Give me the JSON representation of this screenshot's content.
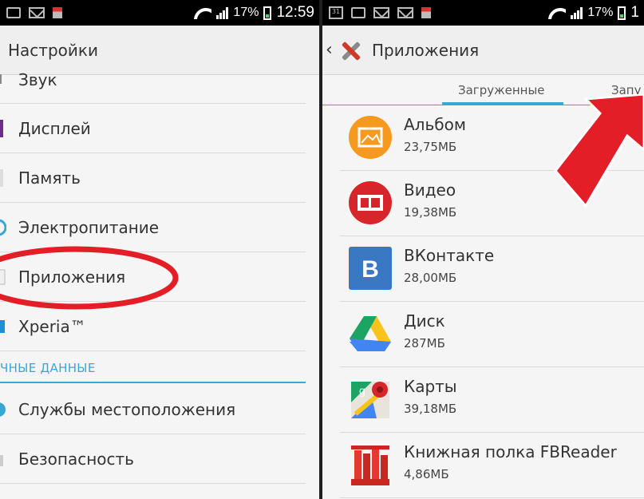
{
  "left": {
    "status": {
      "battery": "17%",
      "time": "12:59"
    },
    "title": "Настройки",
    "items": [
      {
        "label": "Звук"
      },
      {
        "label": "Дисплей"
      },
      {
        "label": "Память"
      },
      {
        "label": "Электропитание"
      },
      {
        "label": "Приложения"
      },
      {
        "label": "Xperia™"
      }
    ],
    "section_header": "ЧНЫЕ ДАННЫЕ",
    "items2": [
      {
        "label": "Службы местоположения"
      },
      {
        "label": "Безопасность"
      }
    ]
  },
  "right": {
    "status": {
      "battery": "17%",
      "time": "1",
      "calendar_day": "31"
    },
    "title": "Приложения",
    "tabs": {
      "downloaded": "Загруженные",
      "running": "Запу"
    },
    "apps": [
      {
        "name": "Альбом",
        "size": "23,75МБ"
      },
      {
        "name": "Видео",
        "size": "19,38МБ"
      },
      {
        "name": "ВКонтакте",
        "size": "28,00МБ",
        "icon_letter": "B"
      },
      {
        "name": "Диск",
        "size": "287МБ"
      },
      {
        "name": "Карты",
        "size": "39,18МБ",
        "icon_letter": "g"
      },
      {
        "name": "Книжная полка FBReader",
        "size": "4,86МБ"
      }
    ]
  },
  "annotations": {
    "highlight_color": "#e41e26",
    "circle_target": "Приложения",
    "arrow_target": "tab-running"
  }
}
